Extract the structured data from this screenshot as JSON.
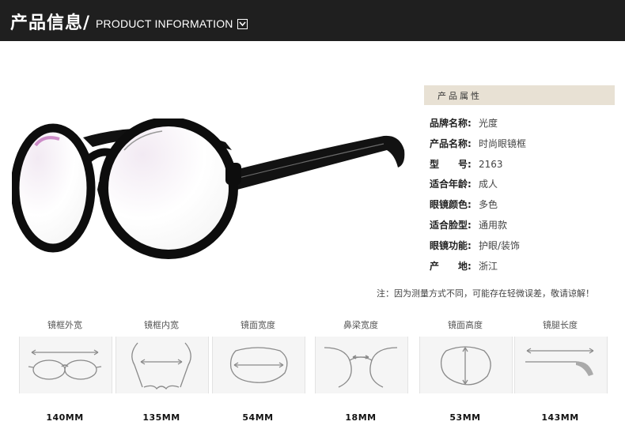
{
  "header": {
    "title_cn": "产品信息/",
    "title_en": "PRODUCT INFORMATION",
    "dropdown_icon": "chevron-down-icon"
  },
  "attributes": {
    "heading": "产品属性",
    "rows": [
      {
        "key": "品牌名称:",
        "value": "光度"
      },
      {
        "key": "产品名称:",
        "value": "时尚眼镜框"
      },
      {
        "key": "型　　号:",
        "value": "2163"
      },
      {
        "key": "适合年龄:",
        "value": "成人"
      },
      {
        "key": "眼镜颜色:",
        "value": "多色"
      },
      {
        "key": "适合脸型:",
        "value": "通用款"
      },
      {
        "key": "眼镜功能:",
        "value": "护眼/装饰"
      },
      {
        "key": "产　　地:",
        "value": "浙江"
      }
    ]
  },
  "note": "注：因为测量方式不同，可能存在轻微误差，敬请谅解！",
  "dimensions": [
    {
      "label": "镜框外宽",
      "value": "140MM",
      "icon": "frame-outer-width-icon"
    },
    {
      "label": "镜框内宽",
      "value": "135MM",
      "icon": "frame-inner-width-icon"
    },
    {
      "label": "镜面宽度",
      "value": "54MM",
      "icon": "lens-width-icon"
    },
    {
      "label": "鼻梁宽度",
      "value": "18MM",
      "icon": "bridge-width-icon"
    },
    {
      "label": "镜面高度",
      "value": "53MM",
      "icon": "lens-height-icon"
    },
    {
      "label": "镜腿长度",
      "value": "143MM",
      "icon": "temple-length-icon"
    }
  ]
}
